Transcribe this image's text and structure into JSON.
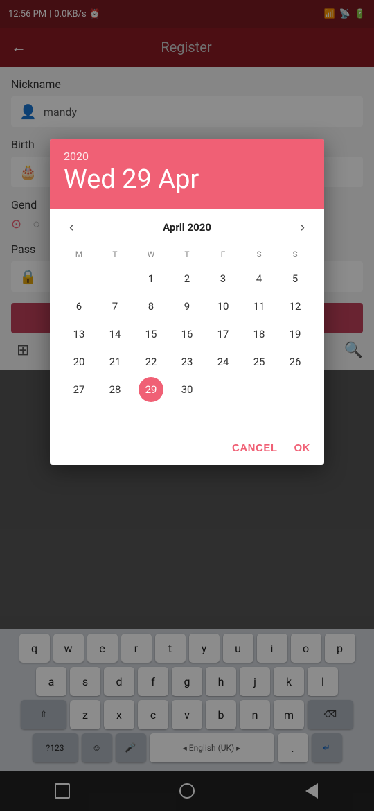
{
  "statusBar": {
    "time": "12:56 PM",
    "dataSpeed": "0.0KB/s",
    "alarmIcon": "⏰"
  },
  "appBar": {
    "title": "Register",
    "backIcon": "←"
  },
  "form": {
    "nicknameLabel": "Nickname",
    "nicknameValue": "mandy",
    "birthLabel": "Birth",
    "genderLabel": "Gend",
    "passwordLabel": "Pass"
  },
  "calendar": {
    "year": "2020",
    "dateDisplay": "Wed 29 Apr",
    "monthTitle": "April 2020",
    "selectedDay": 29,
    "weekdays": [
      "M",
      "T",
      "W",
      "T",
      "F",
      "S",
      "S"
    ],
    "days": [
      {
        "day": "",
        "empty": true
      },
      {
        "day": "",
        "empty": true
      },
      {
        "day": 1
      },
      {
        "day": 2
      },
      {
        "day": 3
      },
      {
        "day": 4
      },
      {
        "day": 5
      },
      {
        "day": 6
      },
      {
        "day": 7
      },
      {
        "day": 8
      },
      {
        "day": 9
      },
      {
        "day": 10
      },
      {
        "day": 11
      },
      {
        "day": 12
      },
      {
        "day": 13
      },
      {
        "day": 14
      },
      {
        "day": 15
      },
      {
        "day": 16
      },
      {
        "day": 17
      },
      {
        "day": 18
      },
      {
        "day": 19
      },
      {
        "day": 20
      },
      {
        "day": 21
      },
      {
        "day": 22
      },
      {
        "day": 23
      },
      {
        "day": 24
      },
      {
        "day": 25
      },
      {
        "day": 26
      },
      {
        "day": 27
      },
      {
        "day": 28
      },
      {
        "day": 29,
        "selected": true
      },
      {
        "day": 30
      },
      {
        "day": "",
        "empty": true
      },
      {
        "day": "",
        "empty": true
      },
      {
        "day": "",
        "empty": true
      },
      {
        "day": "",
        "empty": true
      }
    ],
    "cancelLabel": "CANCEL",
    "okLabel": "OK"
  },
  "keyboard": {
    "row1": [
      "q",
      "w",
      "e",
      "r",
      "t",
      "y",
      "u",
      "i",
      "o",
      "p"
    ],
    "row2": [
      "a",
      "s",
      "d",
      "f",
      "g",
      "h",
      "j",
      "k",
      "l"
    ],
    "row3": [
      "z",
      "x",
      "c",
      "v",
      "b",
      "n",
      "m"
    ],
    "specials": {
      "shift": "⇧",
      "backspace": "⌫",
      "numbers": "?123",
      "emoji": "☺",
      "mic": "🎤",
      "space": "English (UK)",
      "period": ".",
      "enter": "↵"
    }
  }
}
